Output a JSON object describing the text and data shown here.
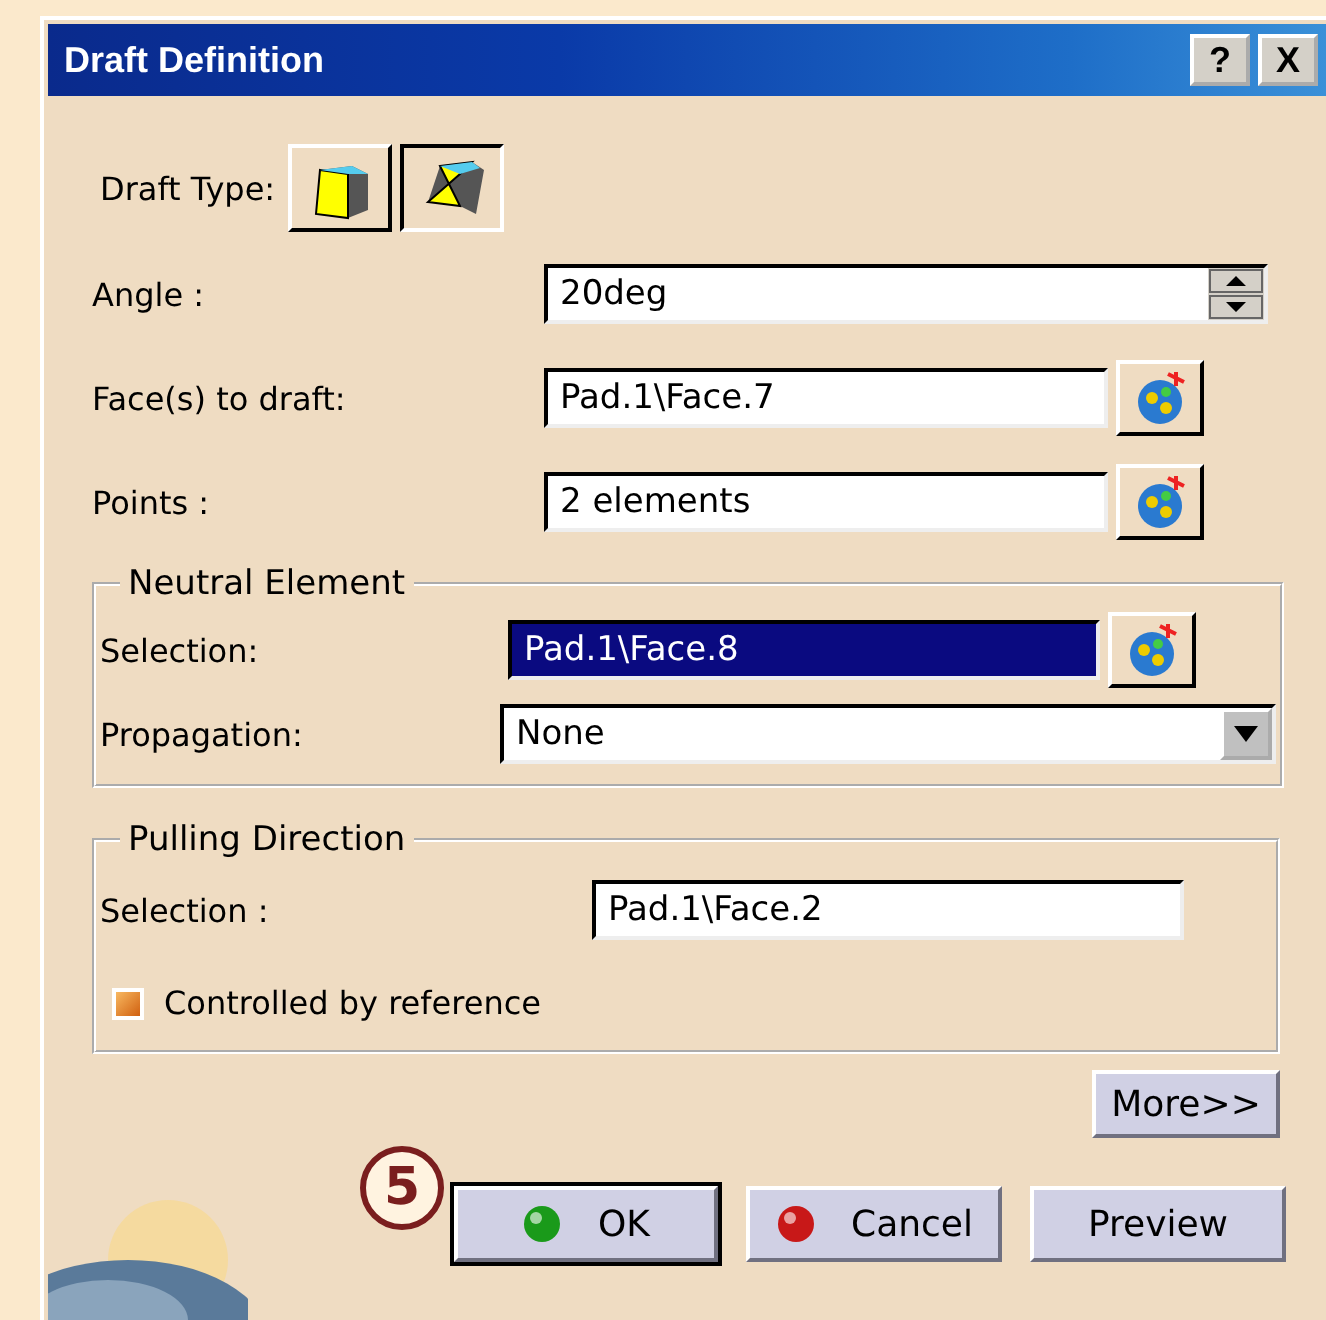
{
  "window": {
    "title": "Draft Definition",
    "buttons": [
      "?",
      "X"
    ]
  },
  "draft_type": {
    "label": "Draft Type:",
    "options": [
      {
        "kind": "constant",
        "selected": false
      },
      {
        "kind": "variable",
        "selected": true
      }
    ]
  },
  "angle": {
    "label": "Angle :",
    "value": "20deg"
  },
  "faces": {
    "label": "Face(s) to draft:",
    "value": "Pad.1\\Face.7"
  },
  "points": {
    "label": "Points :",
    "value": "2 elements"
  },
  "neutral_element": {
    "title": "Neutral Element",
    "selection_label": "Selection:",
    "selection": "Pad.1\\Face.8",
    "selection_selected": true,
    "propagation_label": "Propagation:",
    "propagation": "None"
  },
  "pulling_direction": {
    "title": "Pulling Direction",
    "selection_label": "Selection :",
    "selection": "Pad.1\\Face.2",
    "controlled": {
      "label": "Controlled by reference",
      "checked": true
    }
  },
  "more_button": "More>>",
  "callout": "5",
  "buttons": [
    {
      "kind": "ok",
      "label": "OK",
      "default": true
    },
    {
      "kind": "cancel",
      "label": "Cancel",
      "default": false
    },
    {
      "kind": "plain",
      "label": "Preview",
      "default": false
    }
  ]
}
